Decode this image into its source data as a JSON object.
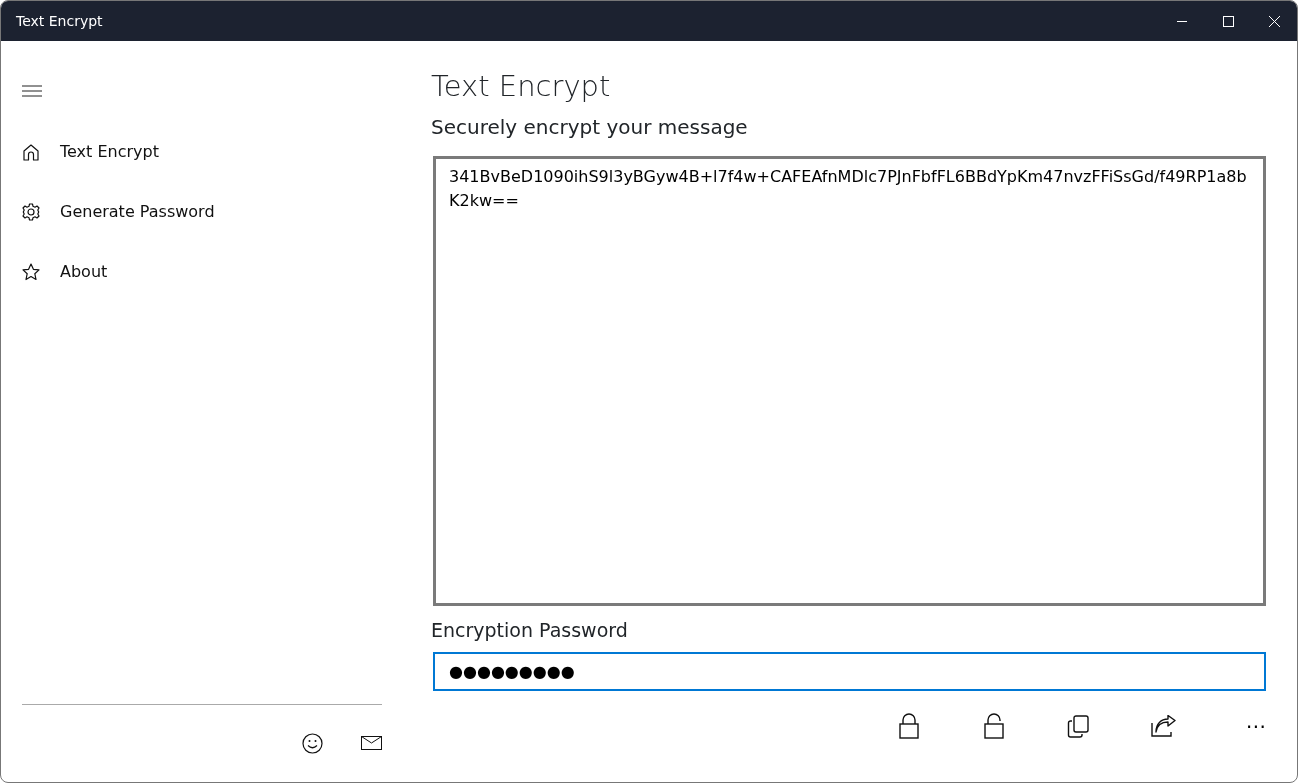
{
  "window": {
    "title": "Text Encrypt"
  },
  "sidebar": {
    "items": [
      {
        "label": "Text Encrypt",
        "kind": "home"
      },
      {
        "label": "Generate Password",
        "kind": "gear"
      },
      {
        "label": "About",
        "kind": "star"
      }
    ]
  },
  "main": {
    "title": "Text Encrypt",
    "subtitle": "Securely encrypt your message",
    "message": {
      "value": "341BvBeD1090ihS9l3yBGyw4B+l7f4w+CAFEAfnMDlc7PJnFbfFL6BBdYpKm47nvzFFiSsGd/f49RP1a8bK2kw=="
    },
    "password_label": "Encryption Password",
    "password": {
      "value": "●●●●●●●●●",
      "focused": true
    }
  },
  "command_bar": {
    "more": "⋯"
  }
}
